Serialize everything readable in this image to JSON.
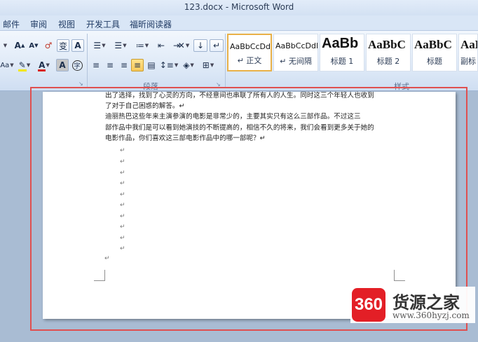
{
  "window": {
    "title": "123.docx - Microsoft Word"
  },
  "tabs": [
    "邮件",
    "审阅",
    "视图",
    "开发工具",
    "福昕阅读器"
  ],
  "font_group": {
    "grow_font": "A",
    "shrink_font": "A",
    "clear_format": "♂",
    "phonetic": "变",
    "char_border": "A",
    "change_case": "Aa",
    "font_color": "A",
    "char_shading": "A",
    "enclose_char": "字"
  },
  "paragraph_group": {
    "label": "段落",
    "sort": "↓",
    "show_marks": "↵"
  },
  "styles_group": {
    "label": "样式",
    "items": [
      {
        "preview": "AaBbCcDdI",
        "name": "↵ 正文"
      },
      {
        "preview": "AaBbCcDdI",
        "name": "↵ 无间隔"
      },
      {
        "preview": "AaBb",
        "name": "标题 1"
      },
      {
        "preview": "AaBbC",
        "name": "标题 2"
      },
      {
        "preview": "AaBbC",
        "name": "标题"
      },
      {
        "preview": "AaB",
        "name": "副标"
      }
    ]
  },
  "document": {
    "lines": [
      "出了选择，找到了心灵的方向，不经意间也串联了所有人的人生。同时这三个年轻人也收到",
      "了对于自己困惑的解答。↵",
      "    迪丽热巴这些年来主演参演的电影是非常少的，主要其实只有这么三部作品。不过这三",
      "部作品中我们是可以看到她演技的不断提高的，相信不久的将来，我们会看到更多关于她的",
      "电影作品，你们喜欢这三部电影作品中的哪一部呢？↵"
    ],
    "paragraph_mark": "↵"
  },
  "watermark": {
    "badge": "360",
    "title": "货源之家",
    "url": "www.360hyzj.com"
  },
  "colors": {
    "highlight": "#e9b148",
    "annotation_box": "#e05050",
    "font_color_bar": "#d9241c",
    "highlight_bar": "#f2e600"
  }
}
